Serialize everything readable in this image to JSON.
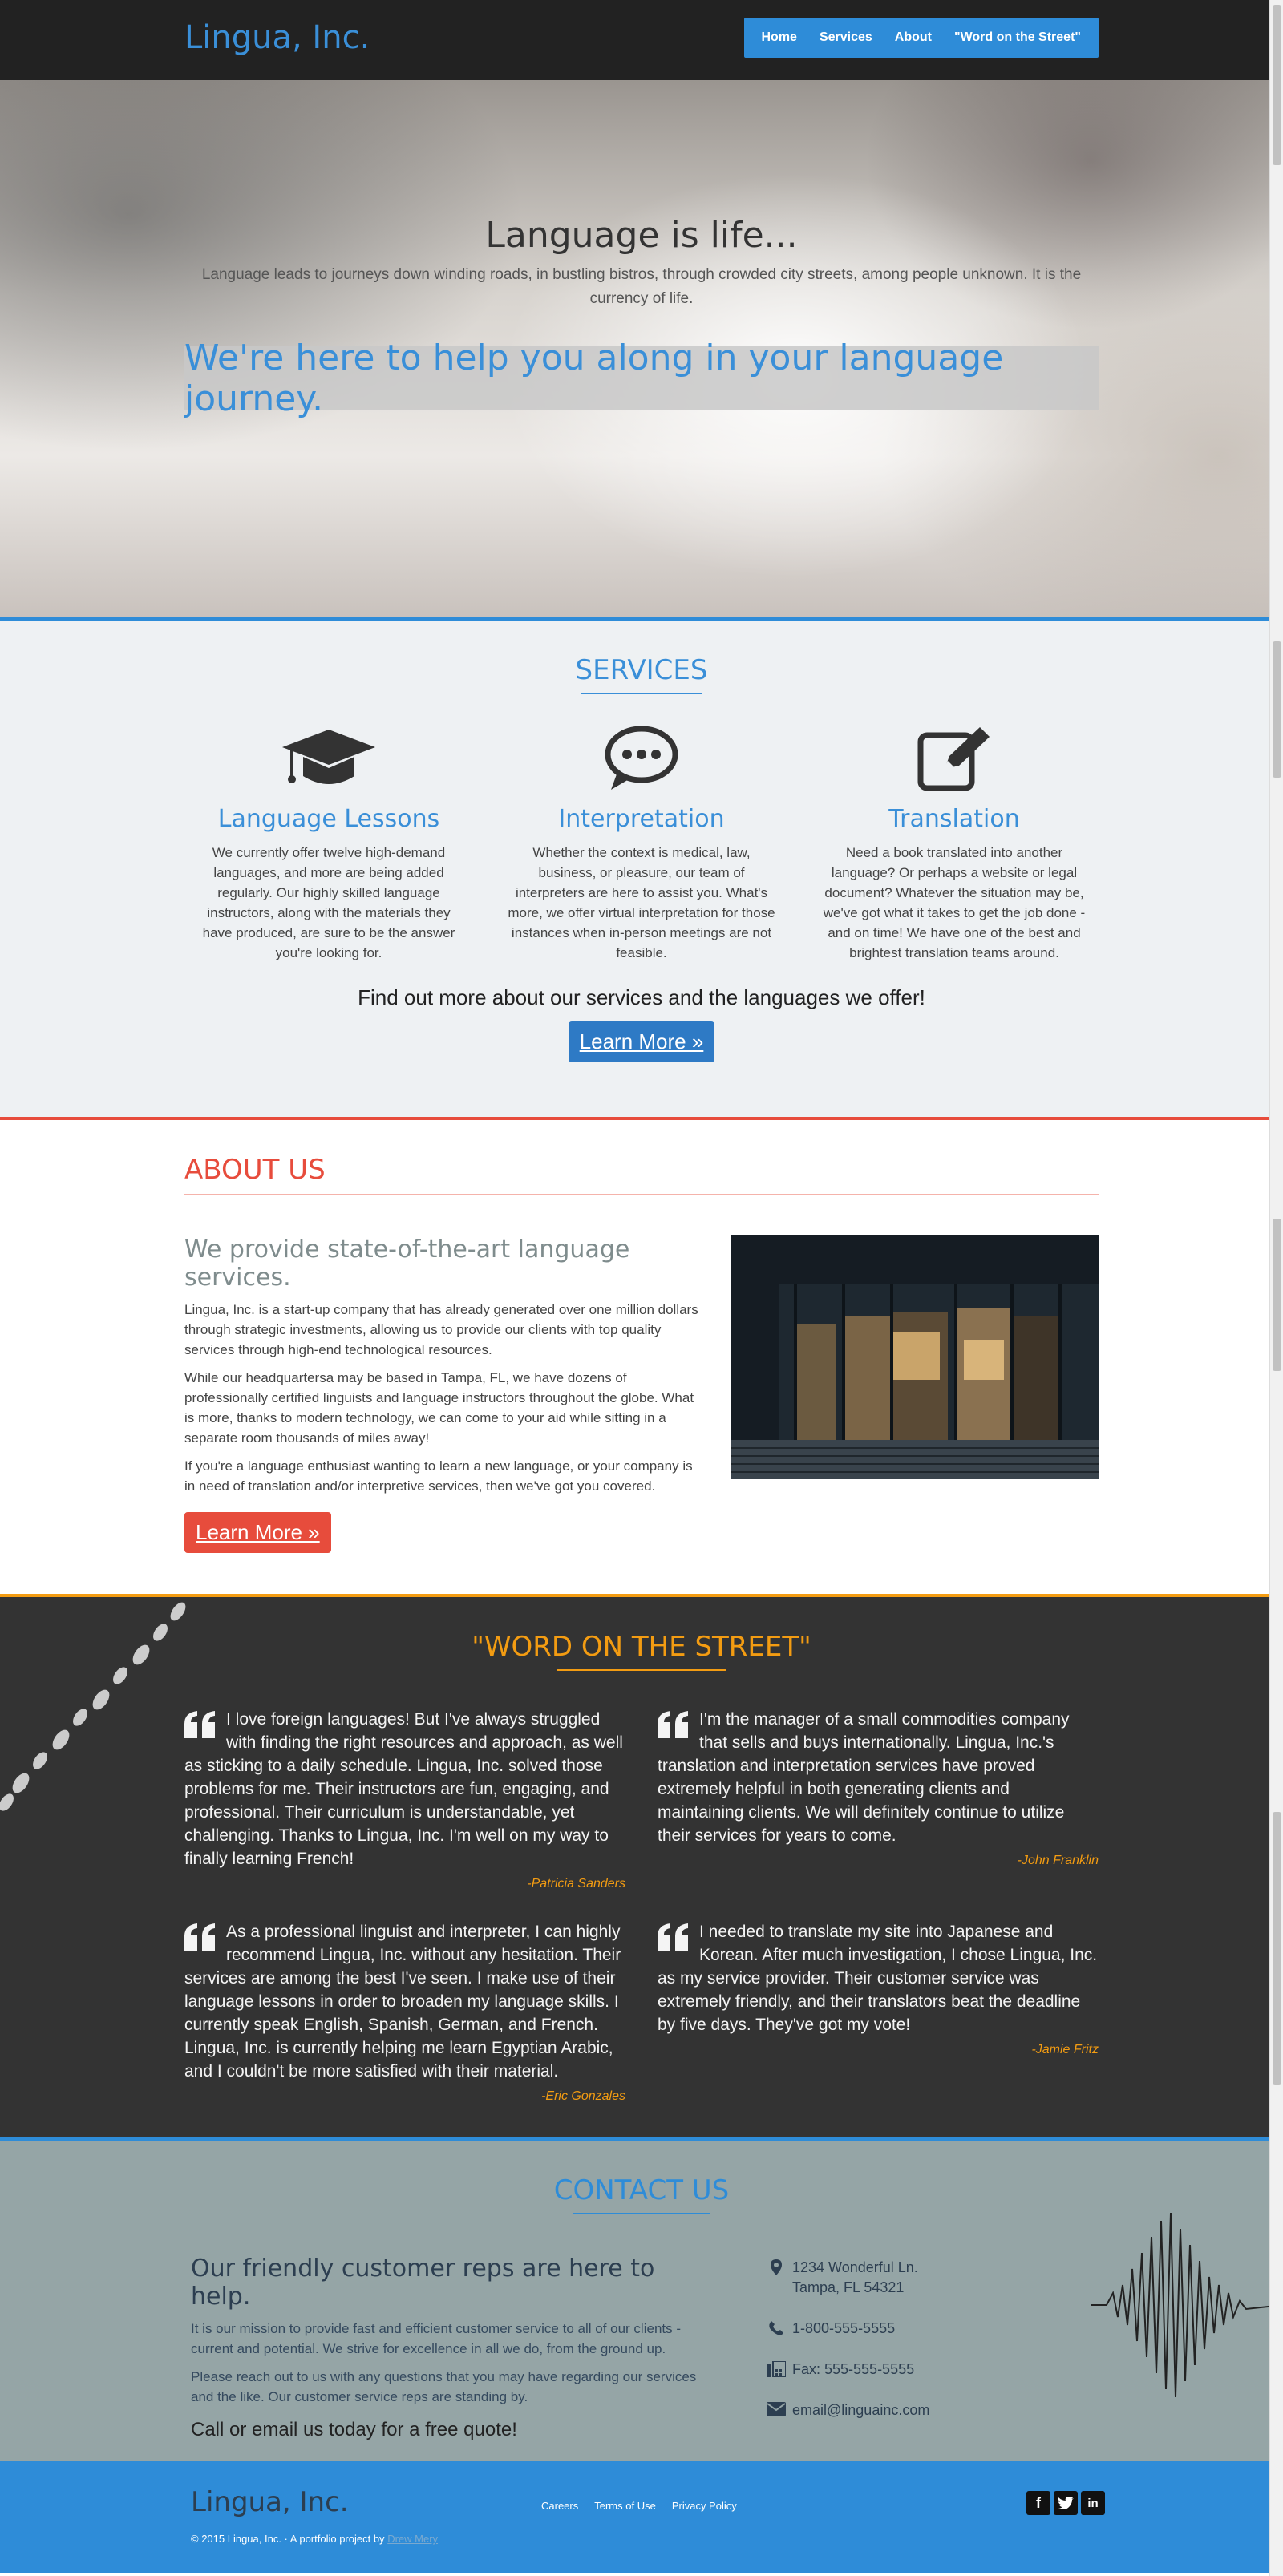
{
  "nav": {
    "brand": "Lingua, Inc.",
    "items": [
      {
        "label": "Home"
      },
      {
        "label": "Services"
      },
      {
        "label": "About"
      },
      {
        "label": "\"Word on the Street\""
      }
    ]
  },
  "hero": {
    "title": "Language is life...",
    "lead": "Language leads to journeys down winding roads, in bustling bistros, through crowded city streets, among people unknown. It is the currency of life.",
    "banner": "We're here to help you along in your language journey."
  },
  "services": {
    "title": "SERVICES",
    "items": [
      {
        "icon": "graduation-cap-icon",
        "title": "Language Lessons",
        "text": "We currently offer twelve high-demand languages, and more are being added regularly. Our highly skilled language instructors, along with the materials they have produced, are sure to be the answer you're looking for."
      },
      {
        "icon": "speech-bubble-icon",
        "title": "Interpretation",
        "text": "Whether the context is medical, law, business, or pleasure, our team of interpreters are here to assist you. What's more, we offer virtual interpretation for those instances when in-person meetings are not feasible."
      },
      {
        "icon": "edit-pencil-icon",
        "title": "Translation",
        "text": "Need a book translated into another language? Or perhaps a website or legal document? Whatever the situation may be, we've got what it takes to get the job done - and on time! We have one of the best and brightest translation teams around."
      }
    ],
    "find_more": "Find out more about our services and the languages we offer!",
    "button": "Learn More »"
  },
  "about": {
    "title": "ABOUT US",
    "subtitle": "We provide state-of-the-art language services.",
    "paragraphs": [
      "Lingua, Inc. is a start-up company that has already generated over one million dollars through strategic investments, allowing us to provide our clients with top quality services through high-end technological resources.",
      "While our headquartersa may be based in Tampa, FL, we have dozens of professionally certified linguists and language instructors throughout the globe. What is more, thanks to modern technology, we can come to your aid while sitting in a separate room thousands of miles away!",
      "If you're a language enthusiast wanting to learn a new language, or your company is in need of translation and/or interpretive services, then we've got you covered."
    ],
    "button": "Learn More »"
  },
  "street": {
    "title": "\"WORD ON THE STREET\"",
    "quotes": [
      {
        "text": "I love foreign languages! But I've always struggled with finding the right resources and approach, as well as sticking to a daily schedule. Lingua, Inc. solved those problems for me. Their instructors are fun, engaging, and professional. Their curriculum is understandable, yet challenging. Thanks to Lingua, Inc. I'm well on my way to finally learning French!",
        "author": "-Patricia Sanders"
      },
      {
        "text": "I'm the manager of a small commodities company that sells and buys internationally. Lingua, Inc.'s translation and interpretation services have proved extremely helpful in both generating clients and maintaining clients. We will definitely continue to utilize their services for years to come.",
        "author": "-John Franklin"
      },
      {
        "text": "As a professional linguist and interpreter, I can highly recommend Lingua, Inc. without any hesitation. Their services are among the best I've seen. I make use of their language lessons in order to broaden my language skills. I currently speak English, Spanish, German, and French. Lingua, Inc. is currently helping me learn Egyptian Arabic, and I couldn't be more satisfied with their material.",
        "author": "-Eric Gonzales"
      },
      {
        "text": "I needed to translate my site into Japanese and Korean. After much investigation, I chose Lingua, Inc. as my service provider. Their customer service was extremely friendly, and their translators beat the deadline by five days. They've got my vote!",
        "author": "-Jamie Fritz"
      }
    ]
  },
  "contact": {
    "title": "CONTACT US",
    "subtitle": "Our friendly customer reps are here to help.",
    "p1": "It is our mission to provide fast and efficient customer service to all of our clients - current and potential. We strive for excellence in all we do, from the ground up.",
    "p2": "Please reach out to us with any questions that you may have regarding our services and the like. Our customer service reps are standing by.",
    "cta": "Call or email us today for a free quote!",
    "address_line1": "1234 Wonderful Ln.",
    "address_line2": "Tampa, FL 54321",
    "phone": "1-800-555-5555",
    "fax": "Fax: 555-555-5555",
    "email": "email@linguainc.com"
  },
  "footer": {
    "brand": "Lingua, Inc.",
    "copy": "© 2015 Lingua, Inc. · A portfolio project by",
    "author": "Drew Mery",
    "links": [
      {
        "label": "Careers"
      },
      {
        "label": "Terms of Use"
      },
      {
        "label": "Privacy Policy"
      }
    ],
    "social": [
      "facebook-icon",
      "twitter-icon",
      "linkedin-icon"
    ]
  },
  "colors": {
    "blue": "#2e8cd8",
    "red": "#e74c3c",
    "orange": "#f39c12",
    "dark": "#333333",
    "nav": "#222222",
    "gray": "#95a5a6"
  }
}
